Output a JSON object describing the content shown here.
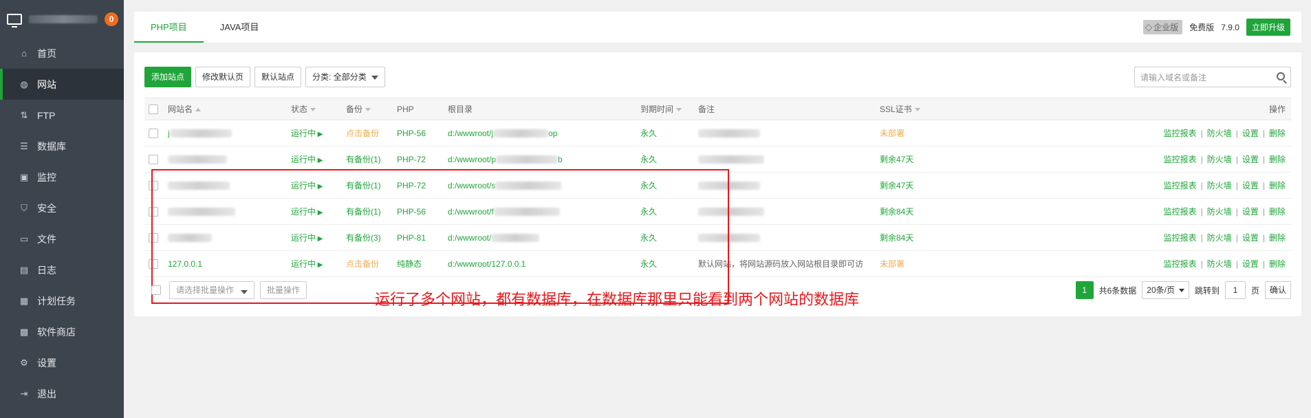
{
  "sidebar": {
    "badge": "0",
    "items": [
      {
        "label": "首页",
        "icon": "home-icon"
      },
      {
        "label": "网站",
        "icon": "globe-icon",
        "active": true
      },
      {
        "label": "FTP",
        "icon": "ftp-icon"
      },
      {
        "label": "数据库",
        "icon": "database-icon"
      },
      {
        "label": "监控",
        "icon": "monitor-icon"
      },
      {
        "label": "安全",
        "icon": "shield-icon"
      },
      {
        "label": "文件",
        "icon": "folder-icon"
      },
      {
        "label": "日志",
        "icon": "log-icon"
      },
      {
        "label": "计划任务",
        "icon": "calendar-icon"
      },
      {
        "label": "软件商店",
        "icon": "grid-icon"
      },
      {
        "label": "设置",
        "icon": "gear-icon"
      },
      {
        "label": "退出",
        "icon": "logout-icon"
      }
    ]
  },
  "tabs": [
    {
      "label": "PHP项目",
      "active": true
    },
    {
      "label": "JAVA项目"
    }
  ],
  "top_right": {
    "enterprise": "企业版",
    "free": "免费版",
    "version": "7.9.0",
    "upgrade": "立即升级"
  },
  "toolbar": {
    "add_site": "添加站点",
    "edit_default_page": "修改默认页",
    "default_site": "默认站点",
    "category": "分类: 全部分类"
  },
  "search": {
    "placeholder": "请输入域名或备注"
  },
  "table": {
    "headers": {
      "name": "网站名",
      "status": "状态",
      "backup": "备份",
      "php": "PHP",
      "root": "根目录",
      "expire": "到期时间",
      "note": "备注",
      "ssl": "SSL证书",
      "ops": "操作"
    },
    "rows": [
      {
        "name": "j",
        "status": "运行中",
        "backup": "点击备份",
        "php": "PHP-56",
        "root_prefix": "d:/wwwroot/j",
        "root_suffix": "op",
        "expire": "永久",
        "note": "",
        "ssl": "未部署"
      },
      {
        "name": "",
        "status": "运行中",
        "backup": "有备份(1)",
        "php": "PHP-72",
        "root_prefix": "d:/wwwroot/p",
        "root_suffix": "b",
        "expire": "永久",
        "note": "",
        "ssl": "剩余47天"
      },
      {
        "name": "",
        "status": "运行中",
        "backup": "有备份(1)",
        "php": "PHP-72",
        "root_prefix": "d:/wwwroot/s",
        "root_suffix": "",
        "expire": "永久",
        "note": "",
        "ssl": "剩余47天"
      },
      {
        "name": "",
        "status": "运行中",
        "backup": "有备份(1)",
        "php": "PHP-56",
        "root_prefix": "d:/wwwroot/f",
        "root_suffix": "",
        "expire": "永久",
        "note": "",
        "ssl": "剩余84天"
      },
      {
        "name": "",
        "status": "运行中",
        "backup": "有备份(3)",
        "php": "PHP-81",
        "root_prefix": "d:/wwwroot/",
        "root_suffix": "",
        "expire": "永久",
        "note": "",
        "ssl": "剩余84天"
      },
      {
        "name": "127.0.0.1",
        "status": "运行中",
        "backup": "点击备份",
        "php": "纯静态",
        "root_prefix": "d:/wwwroot/127.0.0.1",
        "root_suffix": "",
        "expire": "永久",
        "note": "默认网站，将网站源码放入网站根目录即可访",
        "ssl": "未部署"
      }
    ],
    "row_ops": [
      "监控报表",
      "防火墙",
      "设置",
      "删除"
    ]
  },
  "footer": {
    "batch_placeholder": "请选择批量操作",
    "batch_btn": "批量操作"
  },
  "annotation": "运行了多个网站，都有数据库，在数据库那里只能看到两个网站的数据库",
  "pager": {
    "current": "1",
    "total": "共6条数据",
    "page_size": "20条/页",
    "jump_label": "跳转到",
    "jump_value": "1",
    "page_unit": "页",
    "confirm": "确认"
  },
  "colors": {
    "accent": "#20a53a",
    "warn": "#f0ad4e",
    "annotation": "#e8171b"
  }
}
